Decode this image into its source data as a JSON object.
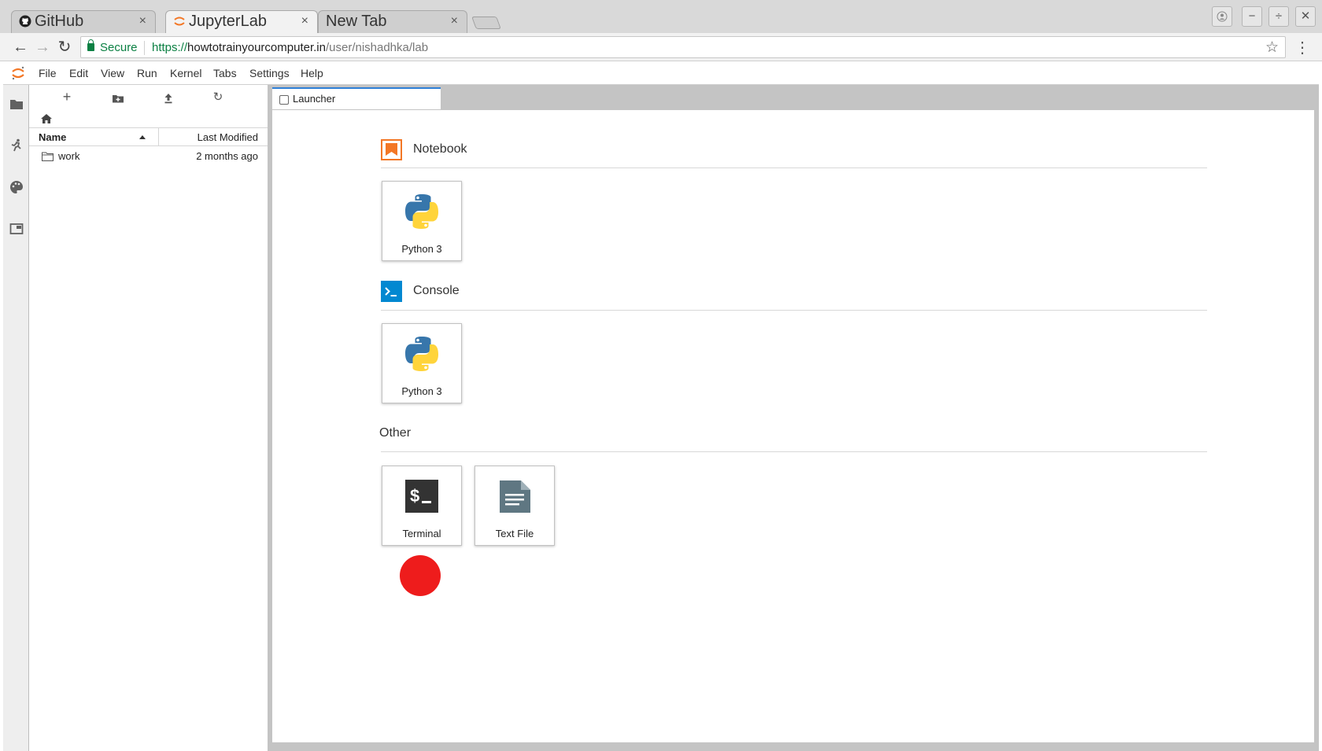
{
  "browser": {
    "tabs": [
      {
        "title": "GitHub",
        "icon": "github-icon",
        "state": "inactive"
      },
      {
        "title": "JupyterLab",
        "icon": "jupyter-icon",
        "state": "active"
      },
      {
        "title": "New Tab",
        "icon": "",
        "state": "inactive"
      }
    ],
    "close_glyph": "×",
    "window_controls": {
      "minimize": "−",
      "restore": "÷",
      "close": "✕"
    },
    "toolbar": {
      "back": "←",
      "forward": "→",
      "reload": "↻",
      "secure_label": "Secure",
      "url_scheme": "https://",
      "url_host": "howtotrainyourcomputer.in",
      "url_path": "/user/nishadhka/lab",
      "star": "☆",
      "menu": "⋮"
    }
  },
  "jupyter": {
    "menubar": [
      "File",
      "Edit",
      "View",
      "Run",
      "Kernel",
      "Tabs",
      "Settings",
      "Help"
    ],
    "filebrowser": {
      "toolbar": {
        "new_launcher": "+",
        "new_folder": "",
        "upload": "",
        "refresh": "↻"
      },
      "columns": {
        "name": "Name",
        "modified": "Last Modified"
      },
      "rows": [
        {
          "name": "work",
          "modified": "2 months ago",
          "type": "folder"
        }
      ]
    },
    "main": {
      "tab_label": "Launcher",
      "launcher": {
        "sections": [
          {
            "title": "Notebook",
            "icon": "notebook-icon",
            "accent": "#f37726",
            "cards": [
              {
                "label": "Python 3",
                "icon": "python-icon"
              }
            ]
          },
          {
            "title": "Console",
            "icon": "console-icon",
            "accent": "#0288d1",
            "cards": [
              {
                "label": "Python 3",
                "icon": "python-icon"
              }
            ]
          },
          {
            "title": "Other",
            "icon": "",
            "cards": [
              {
                "label": "Terminal",
                "icon": "terminal-icon"
              },
              {
                "label": "Text File",
                "icon": "text-file-icon"
              }
            ]
          }
        ]
      }
    }
  },
  "colors": {
    "python_blue": "#3776ab",
    "python_yellow": "#ffd43b",
    "jupyter_orange": "#f37726",
    "secure_green": "#0b8043",
    "marker_red": "#ee1c1c"
  }
}
